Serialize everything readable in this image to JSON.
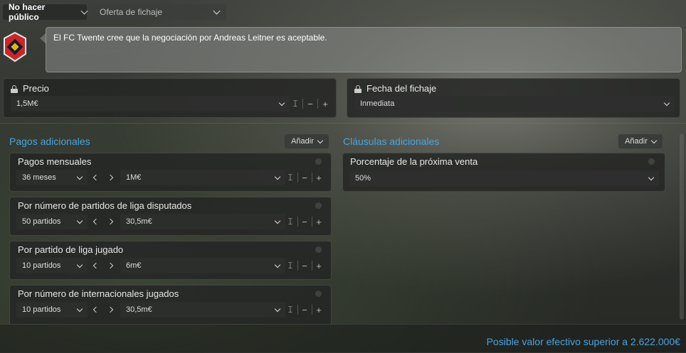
{
  "topbar": {
    "visibility_label": "No hacer público",
    "offer_type_label": "Oferta de fichaje"
  },
  "message": {
    "text": "El FC Twente cree que la negociación por Andreas Leitner es aceptable."
  },
  "price": {
    "title": "Precio",
    "value": "1,5M€"
  },
  "transfer_date": {
    "title": "Fecha del fichaje",
    "value": "Inmediata"
  },
  "additional_payments": {
    "title": "Pagos adicionales",
    "add_label": "Añadir",
    "items": [
      {
        "title": "Pagos mensuales",
        "count": "36 meses",
        "amount": "1M€"
      },
      {
        "title": "Por número de partidos de liga disputados",
        "count": "50 partidos",
        "amount": "30,5m€"
      },
      {
        "title": "Por partido de liga jugado",
        "count": "10 partidos",
        "amount": "6m€"
      },
      {
        "title": "Por número de internacionales jugados",
        "count": "10 partidos",
        "amount": "30,5m€"
      }
    ]
  },
  "additional_clauses": {
    "title": "Cláusulas adicionales",
    "add_label": "Añadir",
    "items": [
      {
        "title": "Porcentaje de la próxima venta",
        "value": "50%"
      }
    ]
  },
  "controls": {
    "lock_glyph": "𝙸",
    "minus": "−",
    "plus": "+"
  },
  "footer": {
    "text": "Posible valor efectivo superior a 2.622.000€"
  },
  "colors": {
    "accent": "#4aa3df",
    "crest_red": "#c8262b"
  }
}
